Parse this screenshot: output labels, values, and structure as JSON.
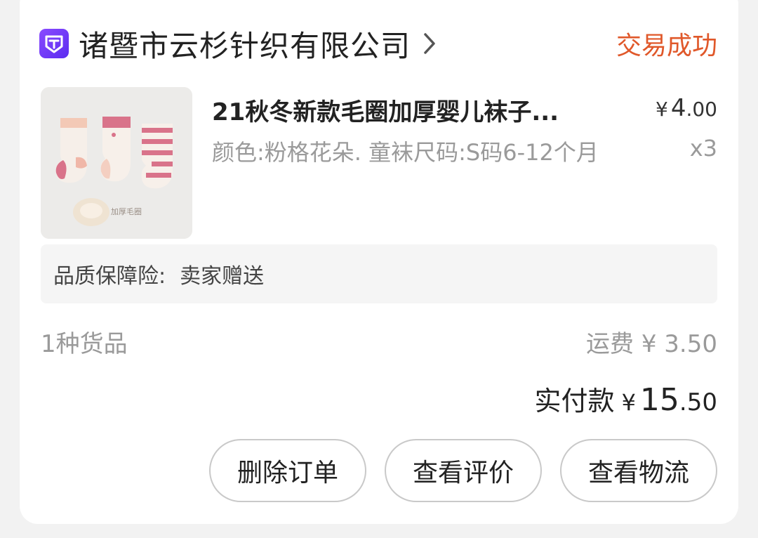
{
  "shop": {
    "name": "诸暨市云杉针织有限公司",
    "status": "交易成功",
    "accent_color": "#e0582a",
    "icon": "shop-badge-icon"
  },
  "item": {
    "image_caption": "加厚毛圈",
    "title": "21秋冬新款毛圈加厚婴儿袜子...",
    "price_currency": "¥",
    "price_int": "4",
    "price_dec": ".00",
    "spec": "颜色:粉格花朵. 童袜尺码:S码6-12个月",
    "quantity": "x3"
  },
  "insurance": {
    "label": "品质保障险:",
    "value": "卖家赠送"
  },
  "summary": {
    "count": "1种货品",
    "shipping_label": "运费",
    "shipping_currency": "¥",
    "shipping_amount": "3.50",
    "total_label": "实付款",
    "total_currency": "¥",
    "total_int": "15",
    "total_dec": ".50"
  },
  "actions": {
    "delete": "删除订单",
    "review": "查看评价",
    "logistics": "查看物流"
  }
}
